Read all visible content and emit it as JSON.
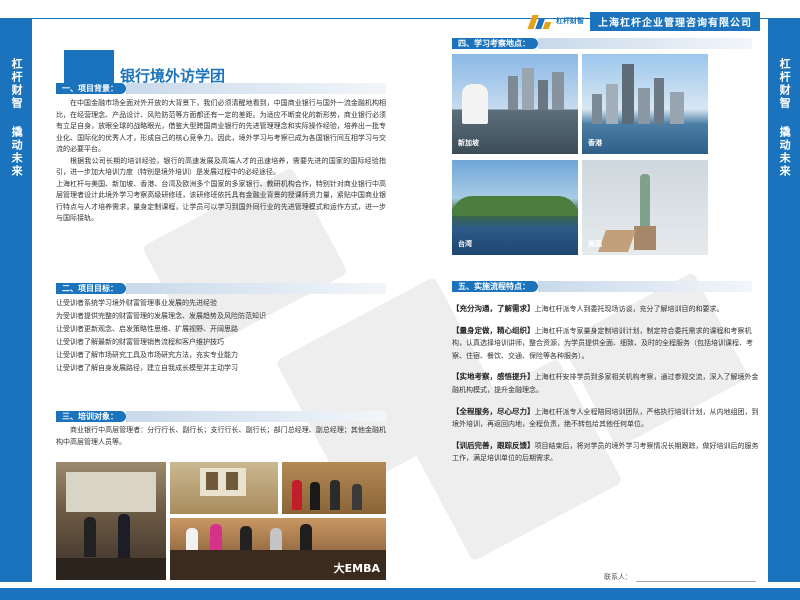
{
  "sidebar": {
    "left": [
      "杠杆财智",
      "撬动未来"
    ],
    "right": [
      "杠杆财智",
      "撬动未来"
    ]
  },
  "header": {
    "logo_small": "杠杆财智",
    "company": "上海杠杆企业管理咨询有限公司"
  },
  "main_title": "银行境外访学团",
  "sections": {
    "background": {
      "heading": "一、项目背景：",
      "paragraphs": [
        "在中国金融市场全面对外开放的大背景下，我们必须清醒地看到，中国商业银行与国外一流金融机构相比，在经营理念、产品设计、风险防范等方面都还有一定的差距。为适应不断变化的新形势，商业银行必须有立足自身，放眼全球的战略眼光，借鉴大型跨国商业银行的先进管理理念和实际操作经验，培养出一批专业化、国际化的优秀人才，形成自己的核心竞争力。因此，境外学习与考察已成为各国银行间互相学习与交流的必要平台。",
        "根据我公司长期的培训经验，银行的高速发展及高端人才的迅速培养，需要先进的国家的国际经验指引，进一步加大培训力度（特别是境外培训）是发展过程中的必经途径。",
        "上海杠杆与美国、新加坡、香港、台湾及欧洲多个国家的多家银行、教研机构合作，特别针对商业银行中高层管理者设计此境外学习考察高级研修班，该研修班依托具有金融业背景的授课师资力量，紧贴中国商业银行特点与人才培养需求，量身定制课程，让学员可以学习到国外同行业的先进管理模式和运作方式，进一步与国际接轨。"
      ]
    },
    "goals": {
      "heading": "二、项目目标：",
      "items": [
        "让受训者系统学习境外财富管理事业发展的先进经验",
        "为受训者提供完整的财富管理的发展理念、发展趋势及风险防范知识",
        "让受训者更新观念、启发策略性思维、扩展视野、开阔思路",
        "让受训者了解最新的财富管理销售流程和客户维护技巧",
        "让受训者了解市场研究工具及市场研究方法，充实专业能力",
        "让受训者了解自身发展路径，建立自我成长模型并主动学习"
      ]
    },
    "audience": {
      "heading": "三、培训对象：",
      "text": "商业银行中高层管理者：分行行长、副行长；支行行长、副行长；部门总经理、副总经理；其他金融机构中高层管理人员等。"
    },
    "locations": {
      "heading": "四、学习考察地点：",
      "places": [
        "新加坡",
        "香港",
        "台湾",
        "美国"
      ]
    },
    "process": {
      "heading": "五、实施流程特点：",
      "items": [
        {
          "title": "【充分沟通，了解需求】",
          "text": "上海杠杆派专人到委托现场访谈，充分了解培训目的和要求。"
        },
        {
          "title": "【量身定做，精心组织】",
          "text": "上海杠杆派专家量身定制培训计划，制定符合委托需求的课程和考察机构，认真选择培训讲师，整合资源，为学员提供全面、细致、及时的全程服务（包括培训课程、考察、住宿、餐饮、交通、保险等各种服务）。"
        },
        {
          "title": "【实地考察，感悟提升】",
          "text": "上海杠杆安排学员到多家相关机构考察，通过参观交流，深入了解境外金融机构模式，提升金融理念。"
        },
        {
          "title": "【全程服务，尽心尽力】",
          "text": "上海杠杆派专人全程陪同培训团队，严格执行培训计划，从内地组团，到境外培训，再返回内地，全程负责，绝不转包给其他任何单位。"
        },
        {
          "title": "【训后完善，跟踪反馈】",
          "text": "项目结束后，将对学员的境外学习考察情况长期跟踪，做好培训后的服务工作，满足培训单位的后期需求。"
        }
      ]
    }
  },
  "photo_watermark": "大EMBA",
  "contact_label": "联系人：",
  "colors": {
    "brand_blue": "#1a73bc",
    "accent_gold": "#e3a218"
  }
}
